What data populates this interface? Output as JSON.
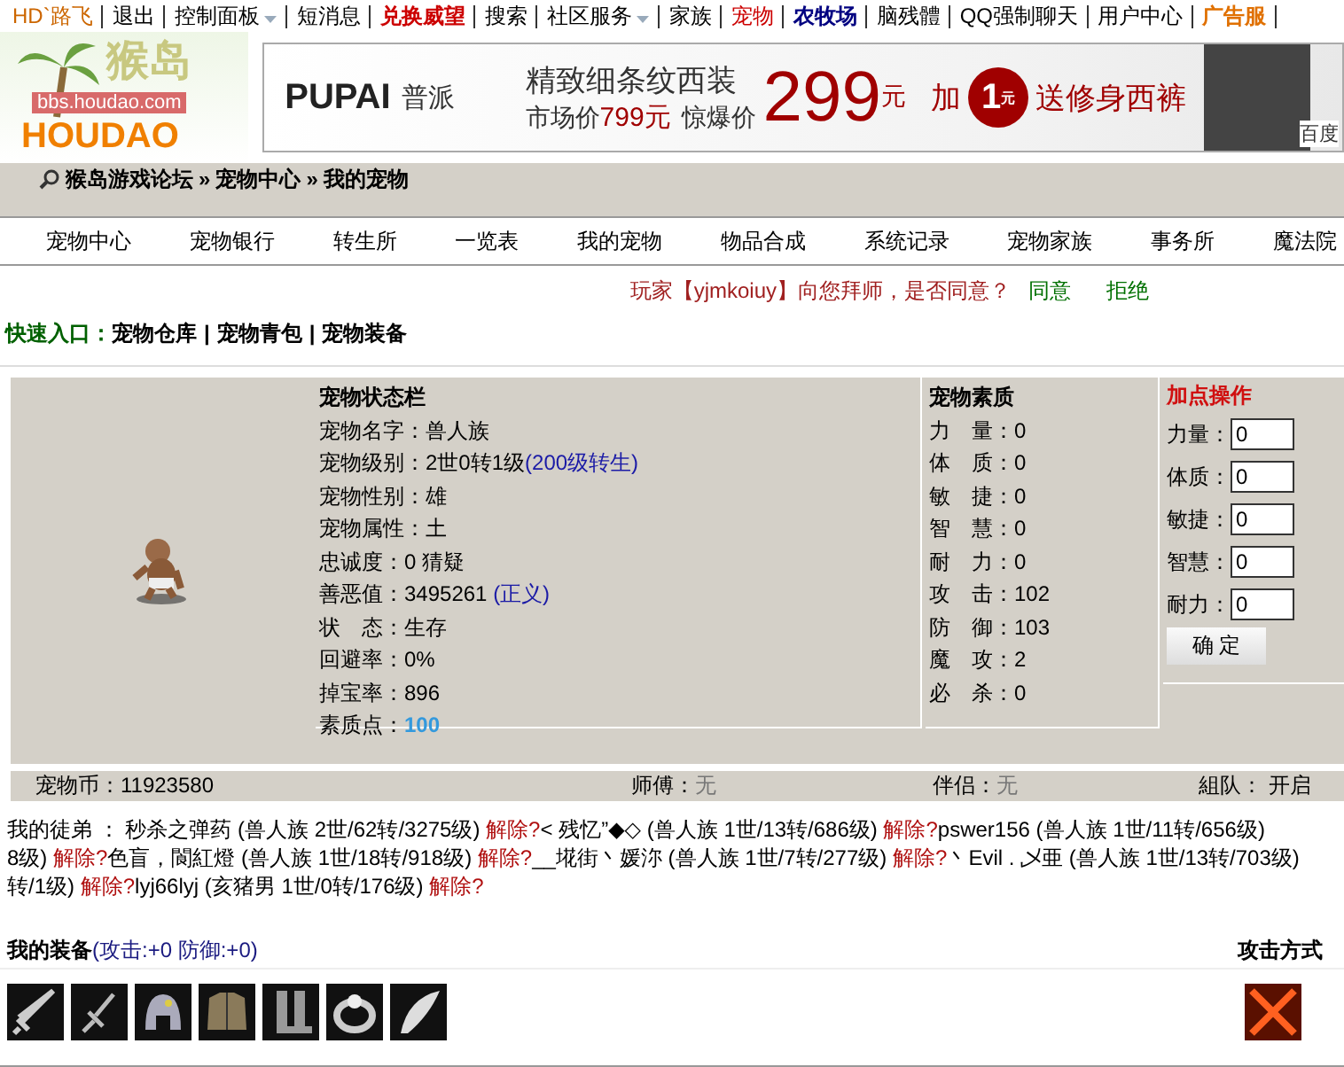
{
  "top_nav": [
    {
      "label": "HD`路飞",
      "color": "#cc6600",
      "bold": false,
      "dropdown": false
    },
    {
      "label": "退出",
      "color": "#000000",
      "bold": false,
      "dropdown": false
    },
    {
      "label": "控制面板",
      "color": "#000000",
      "bold": false,
      "dropdown": true
    },
    {
      "label": "短消息",
      "color": "#000000",
      "bold": false,
      "dropdown": false
    },
    {
      "label": "兑换威望",
      "color": "#cc0000",
      "bold": true,
      "dropdown": false
    },
    {
      "label": "搜索",
      "color": "#000000",
      "bold": false,
      "dropdown": false
    },
    {
      "label": "社区服务",
      "color": "#000000",
      "bold": false,
      "dropdown": true
    },
    {
      "label": "家族",
      "color": "#000000",
      "bold": false,
      "dropdown": false
    },
    {
      "label": "宠物",
      "color": "#cc0000",
      "bold": false,
      "dropdown": false
    },
    {
      "label": "农牧场",
      "color": "#000080",
      "bold": true,
      "dropdown": false
    },
    {
      "label": "脑残體",
      "color": "#000000",
      "bold": false,
      "dropdown": false
    },
    {
      "label": "QQ强制聊天",
      "color": "#000000",
      "bold": false,
      "dropdown": false
    },
    {
      "label": "用户中心",
      "color": "#000000",
      "bold": false,
      "dropdown": false
    },
    {
      "label": "广告服",
      "color": "#e07000",
      "bold": true,
      "dropdown": false
    }
  ],
  "logo": {
    "title": "猴岛",
    "url": "bbs.houdao.com",
    "wordmark": "HOUDAO"
  },
  "banner": {
    "brand": "PUPAI",
    "brand_cn": "普派",
    "headline": "精致细条纹西装",
    "market_label": "市场价",
    "market_price": "799元",
    "deal_label": "惊爆价",
    "deal_price": "299",
    "deal_unit": "元",
    "add_label": "加",
    "badge_value": "1",
    "badge_unit": "元",
    "gift": "送修身西裤",
    "source": "百度"
  },
  "breadcrumb": {
    "separator": "»",
    "items": [
      "猴岛游戏论坛",
      "宠物中心",
      "我的宠物"
    ]
  },
  "tabs": [
    "宠物中心",
    "宠物银行",
    "转生所",
    "一览表",
    "我的宠物",
    "物品合成",
    "系统记录",
    "宠物家族",
    "事务所",
    "魔法院"
  ],
  "notice": {
    "message": "玩家【yjmkoiuy】向您拜师，是否同意？",
    "accept": "同意",
    "reject": "拒绝"
  },
  "quick_links": {
    "label": "快速入口：",
    "separator": "|",
    "links": [
      "宠物仓库",
      "宠物青包",
      "宠物装备"
    ]
  },
  "status_panel": {
    "title": "宠物状态栏",
    "rows": [
      {
        "label": "宠物名字：",
        "value": "兽人族"
      },
      {
        "label": "宠物级别：",
        "value": "2世0转1级",
        "note": "(200级转生)",
        "kind": "link"
      },
      {
        "label": "宠物性别：",
        "value": "雄"
      },
      {
        "label": "宠物属性：",
        "value": "土"
      },
      {
        "label": "忠诚度：",
        "value": "0 猜疑"
      },
      {
        "label": "善恶值：",
        "value": "3495261 ",
        "note": "(正义)",
        "kind": "link"
      },
      {
        "label": "状　态：",
        "value": "生存"
      },
      {
        "label": "回避率：",
        "value": "0%"
      },
      {
        "label": "掉宝率：",
        "value": "896"
      },
      {
        "label": "素质点：",
        "note": "100",
        "kind": "highlight"
      }
    ]
  },
  "quality_panel": {
    "title": "宠物素质",
    "rows": [
      {
        "label": "力　量：",
        "value": "0"
      },
      {
        "label": "体　质：",
        "value": "0"
      },
      {
        "label": "敏　捷：",
        "value": "0"
      },
      {
        "label": "智　慧：",
        "value": "0"
      },
      {
        "label": "耐　力：",
        "value": "0"
      },
      {
        "label": "攻　击：",
        "value": "102"
      },
      {
        "label": "防　御：",
        "value": "103"
      },
      {
        "label": "魔　攻：",
        "value": "2"
      },
      {
        "label": "必　杀：",
        "value": "0"
      }
    ]
  },
  "add_points": {
    "title": "加点操作",
    "fields": [
      {
        "label": "力量：",
        "value": "0"
      },
      {
        "label": "体质：",
        "value": "0"
      },
      {
        "label": "敏捷：",
        "value": "0"
      },
      {
        "label": "智慧：",
        "value": "0"
      },
      {
        "label": "耐力：",
        "value": "0"
      }
    ],
    "button": "确 定"
  },
  "status_bar": {
    "coins": "宠物币：11923580",
    "master_label": "师傅：",
    "master": "无",
    "partner_label": "伴侣：",
    "partner": "无",
    "team": "組队： 开启"
  },
  "disciples": [
    [
      {
        "kind": "text",
        "text": "我的徒弟 ：  秒杀之弹药 (兽人族 2世/62转/3275级) "
      },
      {
        "kind": "link",
        "text": "解除?"
      },
      {
        "kind": "text",
        "text": "< 残忆”◆◇ (兽人族 1世/13转/686级) "
      },
      {
        "kind": "link",
        "text": "解除?"
      },
      {
        "kind": "text",
        "text": "pswer156 (兽人族 1世/11转/656级)"
      }
    ],
    [
      {
        "kind": "text",
        "text": "8级) "
      },
      {
        "kind": "link",
        "text": "解除?"
      },
      {
        "kind": "text",
        "text": "色盲，閬紅燈 (兽人族 1世/18转/918级) "
      },
      {
        "kind": "link",
        "text": "解除?"
      },
      {
        "kind": "text",
        "text": "__埖街丶媛沵 (兽人族 1世/7转/277级) "
      },
      {
        "kind": "link",
        "text": "解除?"
      },
      {
        "kind": "text",
        "text": "丶Evil . 乄亜 (兽人族 1世/13转/703级)"
      }
    ],
    [
      {
        "kind": "text",
        "text": "转/1级) "
      },
      {
        "kind": "link",
        "text": "解除?"
      },
      {
        "kind": "text",
        "text": "lyj66lyj (亥猪男 1世/0转/176级) "
      },
      {
        "kind": "link",
        "text": "解除?"
      }
    ]
  ],
  "equipment": {
    "title": "我的装备",
    "bonus": "(攻击:+0 防御:+0)",
    "attack_title": "攻击方式"
  }
}
